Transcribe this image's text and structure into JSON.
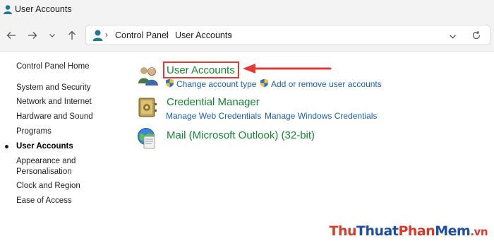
{
  "window": {
    "title": "User Accounts"
  },
  "nav": {
    "back_icon": "arrow-left-icon",
    "forward_icon": "arrow-right-icon",
    "recent_icon": "chevron-down-icon",
    "up_icon": "arrow-up-icon"
  },
  "address": {
    "crumbs": [
      "Control Panel",
      "User Accounts"
    ],
    "dropdown_icon": "chevron-down-icon",
    "refresh_icon": "refresh-icon"
  },
  "sidebar": {
    "items": [
      {
        "label": "Control Panel Home"
      },
      {
        "label": "System and Security"
      },
      {
        "label": "Network and Internet"
      },
      {
        "label": "Hardware and Sound"
      },
      {
        "label": "Programs"
      },
      {
        "label": "User Accounts",
        "active": true
      },
      {
        "label": "Appearance and"
      },
      {
        "label": "Personalisation"
      },
      {
        "label": "Clock and Region"
      },
      {
        "label": "Ease of Access"
      }
    ]
  },
  "main": {
    "categories": [
      {
        "title": "User Accounts",
        "icon": "users-icon",
        "links": [
          "Change account type",
          "Add or remove user accounts"
        ]
      },
      {
        "title": "Credential Manager",
        "icon": "vault-icon",
        "links": [
          "Manage Web Credentials",
          "Manage Windows Credentials"
        ]
      },
      {
        "title": "Mail (Microsoft Outlook) (32-bit)",
        "icon": "mail-icon",
        "links": []
      }
    ]
  },
  "watermark": {
    "parts": [
      "Thu",
      "Thuat",
      "Phan",
      "Mem",
      ".vn"
    ],
    "colors": {
      "primary": "#d83b2c",
      "secondary": "#1f4ea3"
    }
  },
  "colors": {
    "link": "#1a5fb4",
    "category": "#148530",
    "annotation": "#e53935"
  }
}
